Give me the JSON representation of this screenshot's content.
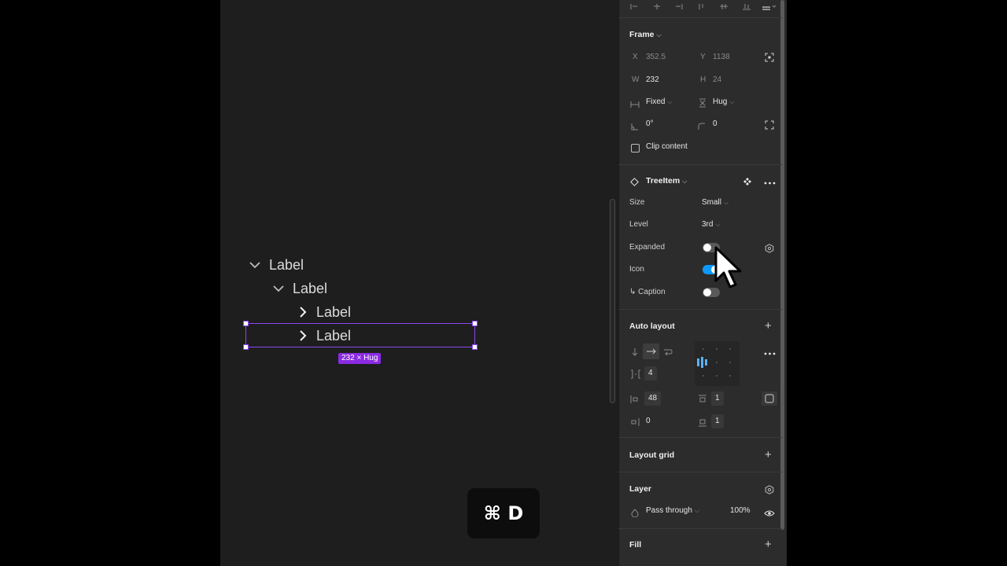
{
  "canvas": {
    "tree": [
      {
        "label": "Label",
        "chevron": "chevron-down"
      },
      {
        "label": "Label",
        "chevron": "chevron-down"
      },
      {
        "label": "Label",
        "chevron": "chevron-right"
      },
      {
        "label": "Label",
        "chevron": "chevron-right"
      }
    ],
    "size_badge": "232 × Hug",
    "shortcut": "⌘ D",
    "accent": "#8a47f0"
  },
  "frame": {
    "title": "Frame",
    "x_label": "X",
    "x_value": "352.5",
    "y_label": "Y",
    "y_value": "1138",
    "w_label": "W",
    "w_value": "232",
    "h_label": "H",
    "h_value": "24",
    "width_mode": "Fixed",
    "height_mode": "Hug",
    "rotation": "0°",
    "radius": "0",
    "clip_label": "Clip content"
  },
  "component": {
    "name": "TreeItem",
    "props": [
      {
        "label": "Size",
        "value": "Small"
      },
      {
        "label": "Level",
        "value": "3rd"
      }
    ],
    "expanded_label": "Expanded",
    "expanded_on": false,
    "icon_label": "Icon",
    "icon_on": true,
    "caption_label": "↳ Caption",
    "caption_on": false,
    "toggle_on_color": "#0d99ff"
  },
  "auto_layout": {
    "title": "Auto layout",
    "gap": "4",
    "padding_h": "48",
    "padding_top": "1",
    "padding_left": "0",
    "padding_bottom": "1"
  },
  "layout_grid": {
    "title": "Layout grid"
  },
  "layer": {
    "title": "Layer",
    "blend": "Pass through",
    "opacity": "100%"
  },
  "fill": {
    "title": "Fill"
  }
}
